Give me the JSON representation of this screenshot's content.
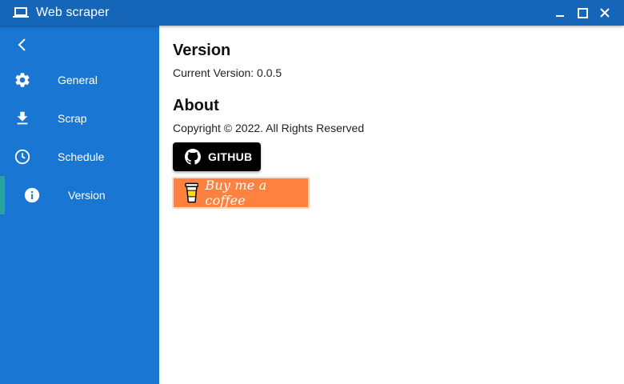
{
  "window": {
    "title": "Web scraper",
    "icons": {
      "app": "laptop-icon",
      "minimize": "minimize-icon",
      "maximize": "maximize-icon",
      "close": "close-icon"
    }
  },
  "sidebar": {
    "back_icon": "chevron-left-icon",
    "items": [
      {
        "label": "General",
        "icon": "gear-icon"
      },
      {
        "label": "Scrap",
        "icon": "download-icon"
      },
      {
        "label": "Schedule",
        "icon": "clock-icon"
      },
      {
        "label": "Version",
        "icon": "info-icon",
        "active": true
      }
    ]
  },
  "main": {
    "version_heading": "Version",
    "current_version": "Current Version: 0.0.5",
    "about_heading": "About",
    "copyright": "Copyright © 2022. All Rights Reserved",
    "github_label": "GITHUB",
    "coffee_label": "Buy me a coffee"
  },
  "colors": {
    "titlebar": "#1565b8",
    "sidebar": "#1976d2",
    "active_indicator": "#26a69a",
    "github_button": "#000000",
    "coffee_button": "#ff813f"
  }
}
